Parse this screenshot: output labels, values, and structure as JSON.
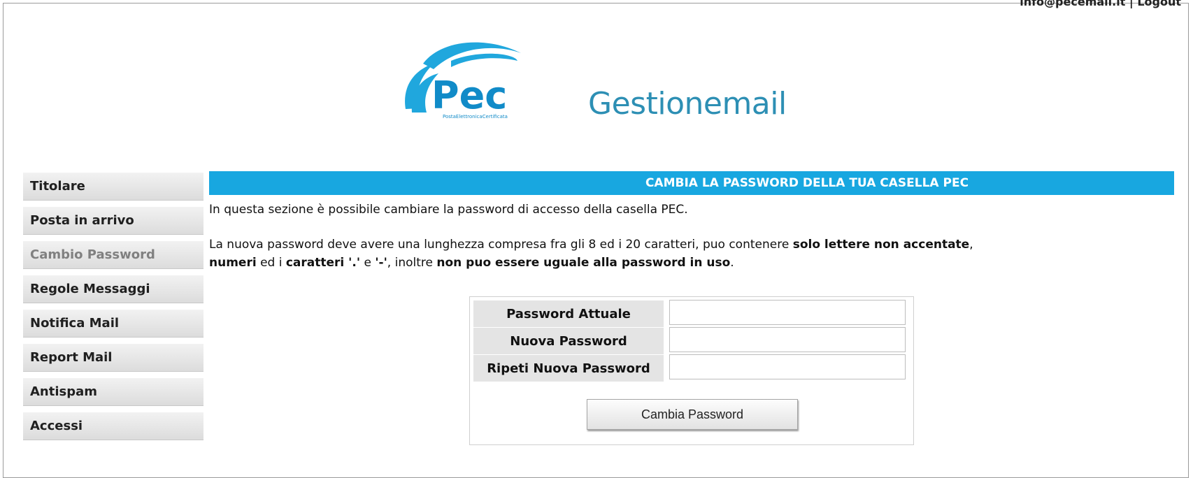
{
  "topbar": {
    "text": "info@pecemail.it | Logout"
  },
  "logo": {
    "text": "Pec",
    "subtext": "PostaElettronicaCertificata"
  },
  "brand": {
    "name": "Gestionemail"
  },
  "sidebar": {
    "items": [
      {
        "label": "Titolare",
        "active": false
      },
      {
        "label": "Posta in arrivo",
        "active": false
      },
      {
        "label": "Cambio Password",
        "active": true
      },
      {
        "label": "Regole Messaggi",
        "active": false
      },
      {
        "label": "Notifica Mail",
        "active": false
      },
      {
        "label": "Report Mail",
        "active": false
      },
      {
        "label": "Antispam",
        "active": false
      },
      {
        "label": "Accessi",
        "active": false
      }
    ]
  },
  "main": {
    "header": "CAMBIA LA PASSWORD DELLA TUA CASELLA PEC",
    "intro": "In questa sezione è possibile cambiare la password di accesso della casella PEC.",
    "rules": {
      "p1": "La nuova password deve avere una lunghezza compresa fra gli 8 ed i 20 caratteri, puo contenere ",
      "b1": "solo lettere non accentate",
      "p2": ",",
      "b2": "numeri",
      "p3": " ed i ",
      "b3": "caratteri '.'",
      "p4": " e ",
      "b4": "'-'",
      "p5": ", inoltre ",
      "b5": "non puo essere uguale alla password in uso",
      "p6": "."
    }
  },
  "form": {
    "fields": [
      {
        "label": "Password Attuale",
        "value": ""
      },
      {
        "label": "Nuova Password",
        "value": ""
      },
      {
        "label": "Ripeti Nuova Password",
        "value": ""
      }
    ],
    "submit_label": "Cambia Password"
  },
  "colors": {
    "accent": "#18a7e0",
    "brand": "#2d8fb4"
  }
}
